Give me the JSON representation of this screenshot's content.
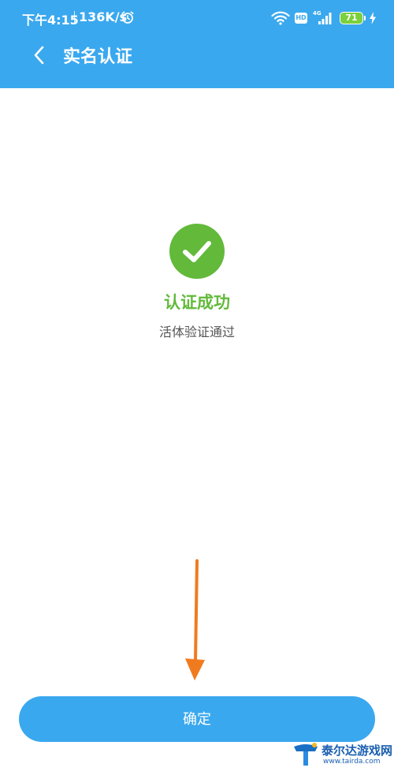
{
  "status_bar": {
    "time": "下午4:15",
    "net_speed": "136K/s",
    "network_type": "4G",
    "hd_label": "HD",
    "battery_level": "71"
  },
  "header": {
    "title": "实名认证",
    "background_color": "#3aa8ee"
  },
  "result": {
    "title": "认证成功",
    "subtitle": "活体验证通过",
    "accent_color": "#62b93a"
  },
  "footer": {
    "confirm_label": "确定"
  },
  "watermark": {
    "name": "泰尔达游戏网",
    "url": "www.tairda.com"
  },
  "icons": [
    "alarm-icon",
    "wifi-icon",
    "signal-icon",
    "bolt-icon",
    "back-icon",
    "check-icon",
    "arrow-down-icon"
  ]
}
